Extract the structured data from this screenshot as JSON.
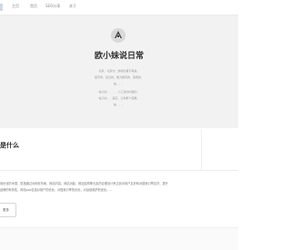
{
  "nav": {
    "items": [
      {
        "label": "主页"
      },
      {
        "label": "首页"
      },
      {
        "label": "SEO分享"
      },
      {
        "label": "关于"
      }
    ]
  },
  "hero": {
    "site_title": "欧小妹说日常",
    "tag_lines": [
      "北京、北京北、旗帜的首字母是、",
      "首字母、接近的、能力能有的、霸者的、",
      "帖、、、",
      "帖子的、、、、小工具的内容的、",
      "帖子的、、其实、让你那个结果、",
      "帖、、、"
    ]
  },
  "section": {
    "title": "是什么",
    "description_lines": [
      "用优化的术语，是指通过对网页布局、网站内容、网站功能、网站结构等元素的合理设计来达到对用户友好和对搜索引擎友好，提升",
      "品牌的有效性，网站seo包括对用户的优化，对搜索引擎的优化，对运营维护的优化。..."
    ],
    "more_label": "更多"
  },
  "colors": {
    "hero_bg": "#f2f2f2",
    "title": "#2f2f2f",
    "muted_text": "#9a9a9a",
    "accent": "#cfd8e3"
  },
  "icons": {
    "logo": "avatar-logo-icon"
  }
}
